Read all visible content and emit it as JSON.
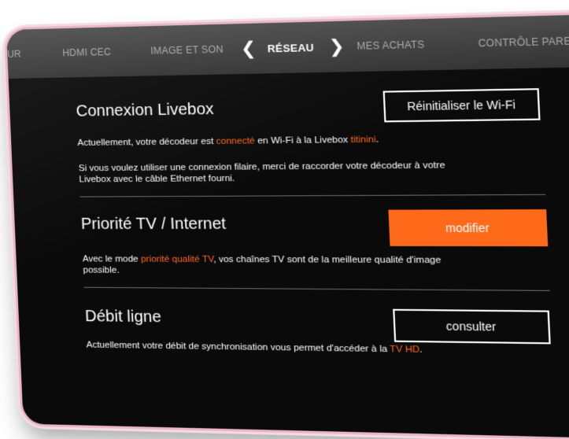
{
  "nav": {
    "items": [
      {
        "label": "UR",
        "active": false
      },
      {
        "label": "HDMI CEC",
        "active": false
      },
      {
        "label": "IMAGE ET SON",
        "active": false
      },
      {
        "label": "RÉSEAU",
        "active": true
      },
      {
        "label": "MES ACHATS",
        "active": false
      },
      {
        "label": "CONTRÔLE PARENTAL",
        "active": false
      }
    ],
    "prev_arrow": "❮",
    "next_arrow": "❯"
  },
  "livebox": {
    "title": "Connexion Livebox",
    "button": "Réinitialiser le Wi-Fi",
    "status_prefix": "Actuellement, votre décodeur est ",
    "status_state": "connecté",
    "status_middle": " en Wi-Fi à la Livebox ",
    "status_network": "titinini",
    "status_suffix": ".",
    "info_line1": "Si vous voulez utiliser une connexion filaire, merci de raccorder votre décodeur à votre",
    "info_line2": "Livebox avec le câble Ethernet fourni."
  },
  "priority": {
    "title": "Priorité TV / Internet",
    "button": "modifier",
    "text_prefix": "Avec le mode ",
    "text_mode": "priorité qualité TV",
    "text_line1_suffix": ", vos chaînes TV sont de la meilleure qualité d'image",
    "text_line2": "possible."
  },
  "speed": {
    "title": "Débit ligne",
    "button": "consulter",
    "text_prefix": "Actuellement votre débit de synchronisation vous permet d'accéder à la ",
    "text_hd": "TV HD",
    "text_suffix": "."
  },
  "colors": {
    "accent": "#ff6a1a",
    "background": "#0a0a0a",
    "frame": "#e9b6c8"
  }
}
